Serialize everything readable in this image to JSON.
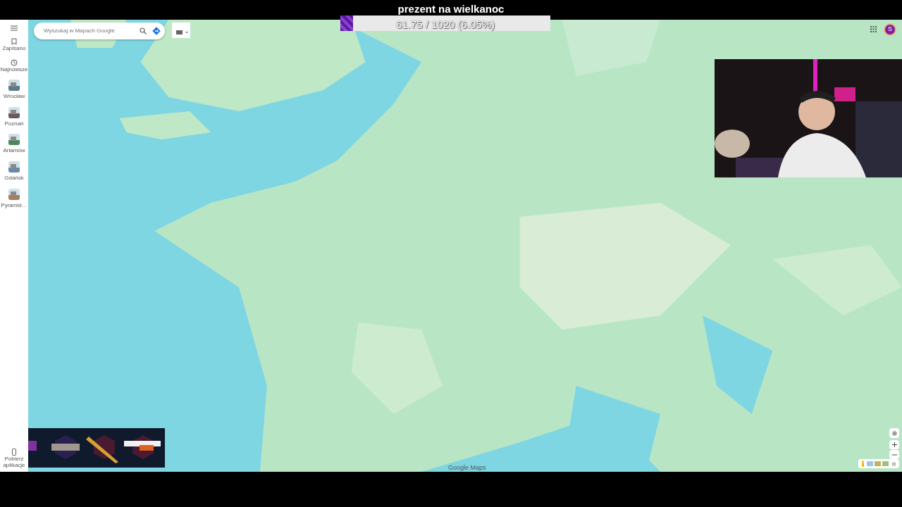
{
  "goal": {
    "title": "prezent na wielkanoc",
    "progress": "61.75 / 1020 (6.05%)",
    "level": 0.0605
  },
  "sidebar": {
    "items": [
      {
        "kind": "saved",
        "label": "Zapisano"
      },
      {
        "kind": "recent",
        "label": "Najnowsze"
      },
      {
        "kind": "place",
        "label": "Wrocław"
      },
      {
        "kind": "place",
        "label": "Poznań"
      },
      {
        "kind": "place",
        "label": "Arłamów"
      },
      {
        "kind": "place",
        "label": "Gdańsk"
      },
      {
        "kind": "place",
        "label": "Pyramid…"
      }
    ],
    "download": "Pobierz aplikacje"
  },
  "search": {
    "placeholder": "Wyszukaj w Mapach Google"
  },
  "account": {
    "initial": "S"
  },
  "attribution": "Google Maps"
}
